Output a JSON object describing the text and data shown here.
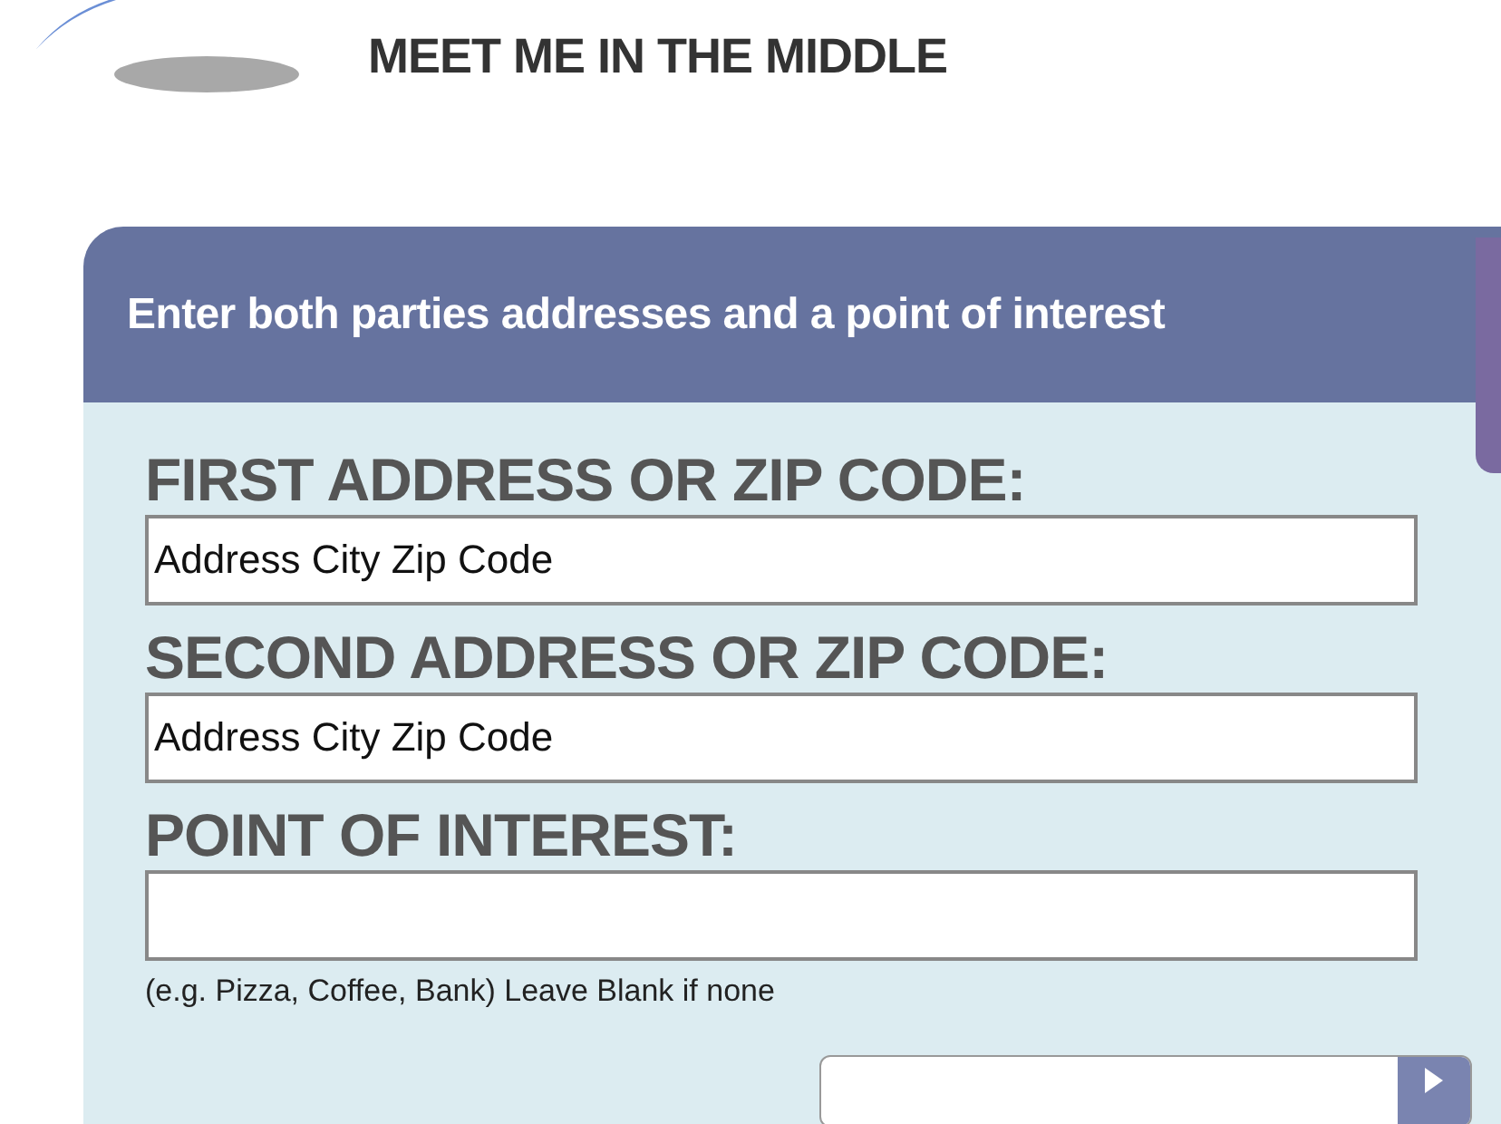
{
  "logo": {
    "tagline": "MEET ME IN THE MIDDLE"
  },
  "panel": {
    "heading": "Enter both parties addresses and a point of interest"
  },
  "fields": [
    {
      "label": "FIRST ADDRESS OR ZIP CODE:",
      "value": "Address City Zip Code"
    },
    {
      "label": "SECOND ADDRESS OR ZIP CODE:",
      "value": "Address City Zip Code"
    },
    {
      "label": "POINT OF INTEREST:"
    }
  ],
  "hint": "(e.g. Pizza, Coffee, Bank) Leave Blank if none"
}
